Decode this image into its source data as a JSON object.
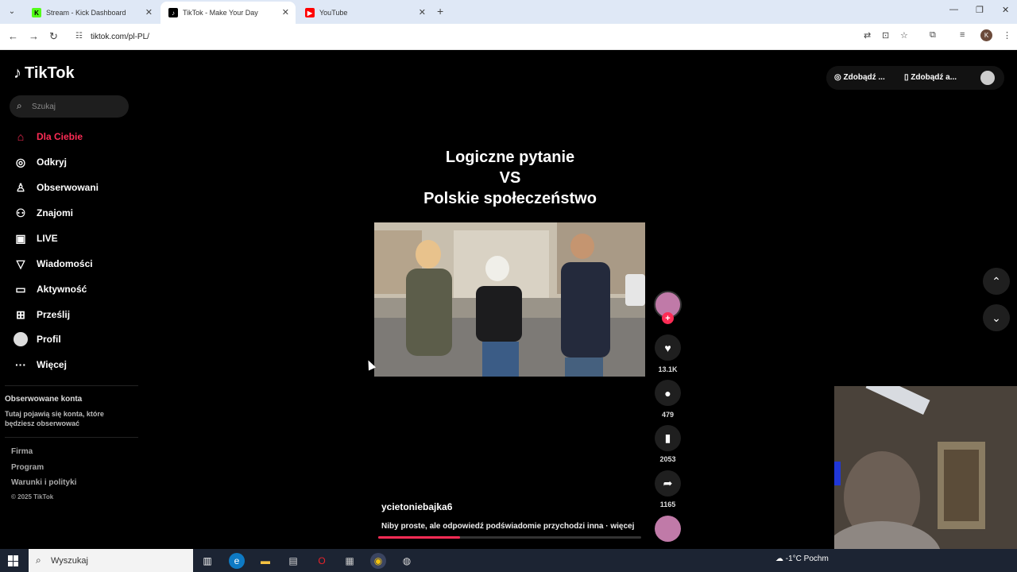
{
  "browser": {
    "tabs": [
      {
        "title": "Stream - Kick Dashboard",
        "favicon": "kick-icon",
        "color": "#53fc18"
      },
      {
        "title": "TikTok - Make Your Day",
        "favicon": "tiktok-icon",
        "color": "#000000"
      },
      {
        "title": "YouTube",
        "favicon": "youtube-icon",
        "color": "#ff0000"
      }
    ],
    "url": "tiktok.com/pl-PL/",
    "profile_initial": "K"
  },
  "tiktok": {
    "logo": "TikTok",
    "search_placeholder": "Szukaj",
    "nav": [
      {
        "label": "Dla Ciebie",
        "icon": "home-icon",
        "active": true
      },
      {
        "label": "Odkryj",
        "icon": "compass-icon"
      },
      {
        "label": "Obserwowani",
        "icon": "following-icon"
      },
      {
        "label": "Znajomi",
        "icon": "friends-icon"
      },
      {
        "label": "LIVE",
        "icon": "live-icon"
      },
      {
        "label": "Wiadomości",
        "icon": "messages-icon"
      },
      {
        "label": "Aktywność",
        "icon": "activity-icon"
      },
      {
        "label": "Prześlij",
        "icon": "upload-icon"
      },
      {
        "label": "Profil",
        "icon": "profile-avatar"
      },
      {
        "label": "Więcej",
        "icon": "more-icon"
      }
    ],
    "followed_heading": "Obserwowane konta",
    "followed_text": "Tutaj pojawią się konta, które będziesz obserwować",
    "footer": [
      "Firma",
      "Program",
      "Warunki i polityki"
    ],
    "copyright": "© 2025 TikTok",
    "top_right": {
      "coins": "Zdobądź ...",
      "app": "Zdobądź a..."
    },
    "video": {
      "title_lines": [
        "Logiczne pytanie",
        "VS",
        "Polskie społeczeństwo"
      ],
      "likes": "13.1K",
      "comments": "479",
      "saves": "2053",
      "shares": "1165",
      "author": "ycietoniebajka6",
      "caption": "Niby proste, ale odpowiedź podświadomie przychodzi inna · więcej",
      "progress": 0.31
    }
  },
  "taskbar": {
    "search_placeholder": "Wyszukaj",
    "weather": "-1°C  Pochm"
  }
}
